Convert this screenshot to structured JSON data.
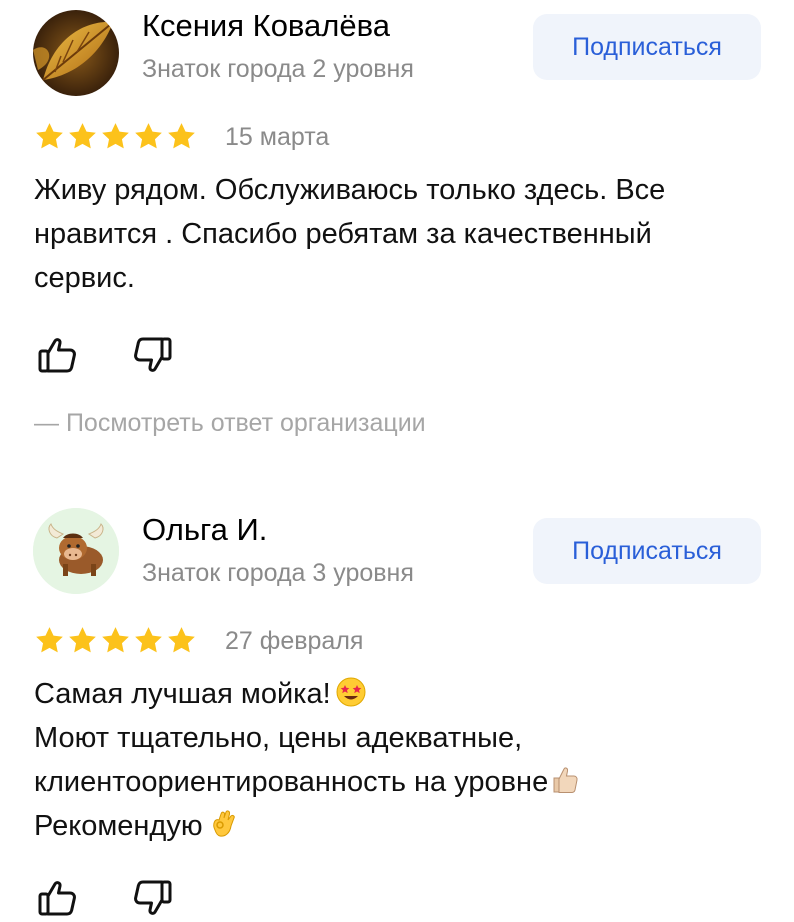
{
  "reviews": [
    {
      "author": "Ксения Ковалёва",
      "level": "Знаток города 2 уровня",
      "subscribe_label": "Подписаться",
      "rating": 5,
      "date": "15 марта",
      "text_lines": [
        "Живу рядом. Обслуживаюсь только здесь. Все",
        "нравится . Спасибо ребятам за качественный",
        "сервис."
      ],
      "org_reply_label": "— Посмотреть ответ организации"
    },
    {
      "author": "Ольга И.",
      "level": "Знаток города 3 уровня",
      "subscribe_label": "Подписаться",
      "rating": 5,
      "date": "27 февраля",
      "text_lines": [
        "Самая лучшая мойка!",
        "Моют тщательно, цены адекватные,",
        "клиентоориентированность на уровне",
        "Рекомендую"
      ]
    }
  ],
  "icons": {
    "like": "thumbs-up-icon",
    "dislike": "thumbs-down-icon",
    "star": "star-icon",
    "emoji_star_struck": "star-struck-emoji",
    "emoji_thumbs_up": "thumbs-up-emoji",
    "emoji_ok_hand": "ok-hand-emoji"
  },
  "colors": {
    "star": "#fcc21b",
    "link_blue": "#2a5fd8",
    "button_bg": "#f0f4fb",
    "secondary_text": "#8a8a8a",
    "reply_text": "#a6a6a6"
  }
}
